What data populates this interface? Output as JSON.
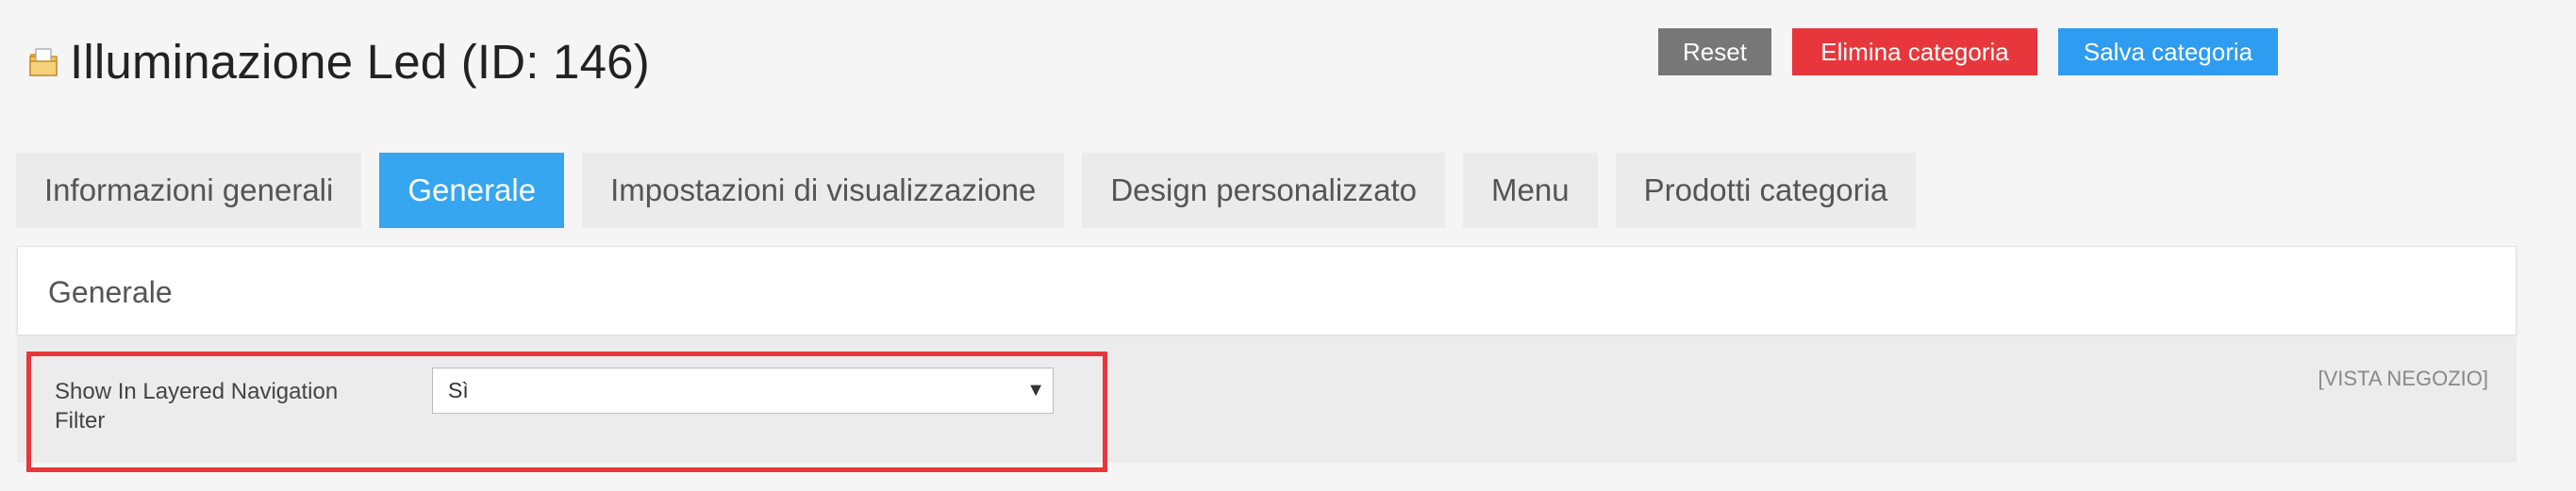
{
  "header": {
    "title": "Illuminazione Led (ID: 146)",
    "icon": "folder-icon"
  },
  "actions": {
    "reset_label": "Reset",
    "delete_label": "Elimina categoria",
    "save_label": "Salva categoria"
  },
  "tabs": [
    {
      "label": "Informazioni generali",
      "active": false
    },
    {
      "label": "Generale",
      "active": true
    },
    {
      "label": "Impostazioni di visualizzazione",
      "active": false
    },
    {
      "label": "Design personalizzato",
      "active": false
    },
    {
      "label": "Menu",
      "active": false
    },
    {
      "label": "Prodotti categoria",
      "active": false
    }
  ],
  "panel": {
    "title": "Generale"
  },
  "field": {
    "label": "Show In Layered Navigation Filter",
    "value": "Sì",
    "scope": "[VISTA NEGOZIO]"
  },
  "colors": {
    "reset": "#777777",
    "delete": "#e8373c",
    "save": "#2e9cf0",
    "active_tab": "#35a6ef",
    "highlight": "#e8373c"
  }
}
